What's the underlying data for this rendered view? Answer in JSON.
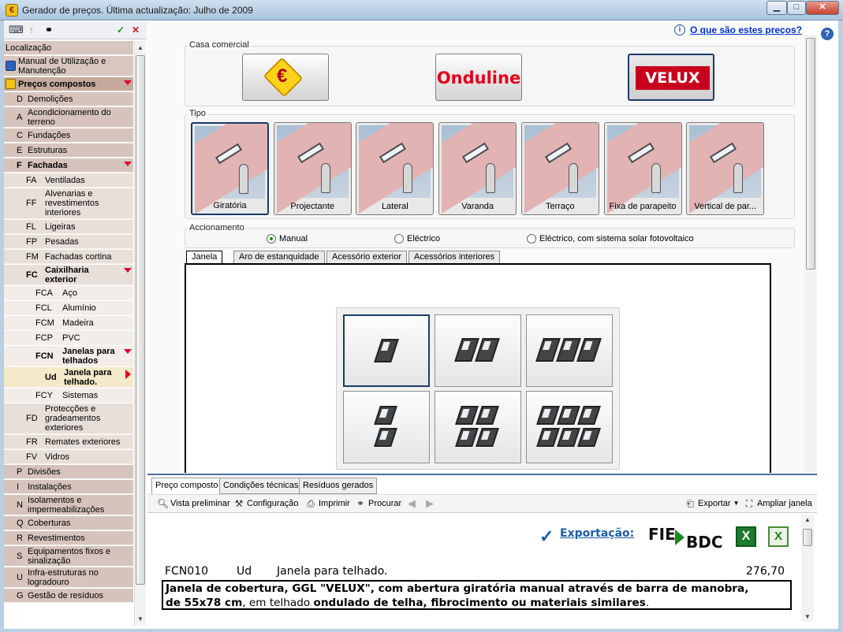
{
  "window": {
    "title": "Gerador de preços. Última actualização: Julho de 2009",
    "app_icon": "euro-icon"
  },
  "help_link": "O que são estes preços?",
  "tree": [
    {
      "code": "",
      "label": "Localização",
      "level": 0,
      "bg": "#d9c7bf"
    },
    {
      "code": "",
      "label": "Manual de Utilização e Manutenção",
      "level": 0,
      "bg": "#d9c7bf",
      "icon": "pencil-icon"
    },
    {
      "code": "",
      "label": "Preços compostos",
      "level": 0,
      "bg": "#c4a99c",
      "bold": true,
      "expanded": true,
      "icon": "euro-icon"
    },
    {
      "code": "D",
      "label": "Demolições",
      "level": 1
    },
    {
      "code": "A",
      "label": "Acondicionamento do terreno",
      "level": 1
    },
    {
      "code": "C",
      "label": "Fundações",
      "level": 1
    },
    {
      "code": "E",
      "label": "Estruturas",
      "level": 1
    },
    {
      "code": "F",
      "label": "Fachadas",
      "level": 1,
      "bold": true,
      "expanded": true
    },
    {
      "code": "FA",
      "label": "Ventiladas",
      "level": 2
    },
    {
      "code": "FF",
      "label": "Alvenarias e revestimentos interiores",
      "level": 2
    },
    {
      "code": "FL",
      "label": "Ligeiras",
      "level": 2
    },
    {
      "code": "FP",
      "label": "Pesadas",
      "level": 2
    },
    {
      "code": "FM",
      "label": "Fachadas cortina",
      "level": 2
    },
    {
      "code": "FC",
      "label": "Caixilharia exterior",
      "level": 2,
      "bold": true,
      "expanded": true
    },
    {
      "code": "FCA",
      "label": "Aço",
      "level": 3
    },
    {
      "code": "FCL",
      "label": "Alumínio",
      "level": 3
    },
    {
      "code": "FCM",
      "label": "Madeira",
      "level": 3
    },
    {
      "code": "FCP",
      "label": "PVC",
      "level": 3
    },
    {
      "code": "FCN",
      "label": "Janelas para telhados",
      "level": 3,
      "bold": true,
      "expanded": true
    },
    {
      "code": "Ud",
      "label": "Janela para telhado.",
      "level": 4,
      "bold": true,
      "selected": true
    },
    {
      "code": "FCY",
      "label": "Sistemas",
      "level": 3
    },
    {
      "code": "FD",
      "label": "Protecções e gradeamentos exteriores",
      "level": 2
    },
    {
      "code": "FR",
      "label": "Remates exteriores",
      "level": 2
    },
    {
      "code": "FV",
      "label": "Vidros",
      "level": 2
    },
    {
      "code": "P",
      "label": "Divisões",
      "level": 1
    },
    {
      "code": "I",
      "label": "Instalações",
      "level": 1
    },
    {
      "code": "N",
      "label": "Isolamentos e impermeabilizações",
      "level": 1
    },
    {
      "code": "Q",
      "label": "Coberturas",
      "level": 1
    },
    {
      "code": "R",
      "label": "Revestimentos",
      "level": 1
    },
    {
      "code": "S",
      "label": "Equipamentos fixos e sinalização",
      "level": 1
    },
    {
      "code": "U",
      "label": "Infra-estruturas no logradouro",
      "level": 1
    },
    {
      "code": "G",
      "label": "Gestão de resíduos",
      "level": 1
    }
  ],
  "casa_comercial": {
    "label": "Casa comercial",
    "brands": [
      {
        "name": "euro-brand",
        "text": "€",
        "selected": false
      },
      {
        "name": "onduline",
        "text": "Onduline",
        "selected": false
      },
      {
        "name": "velux",
        "text": "VELUX",
        "selected": true
      }
    ]
  },
  "tipo": {
    "label": "Tipo",
    "options": [
      "Giratória",
      "Projectante",
      "Lateral",
      "Varanda",
      "Terraço",
      "Fixa de parapeito",
      "Vertical de par..."
    ],
    "selected_index": 0
  },
  "accionamento": {
    "label": "Accionamento",
    "options": [
      "Manual",
      "Eléctrico",
      "Eléctrico, com sistema solar fotovoltaico"
    ],
    "selected_index": 0
  },
  "tabs": [
    "Janela",
    "Aro de estanquidade",
    "Acessório exterior",
    "Acessórios interiores"
  ],
  "bottom_tabs": [
    "Preço composto",
    "Condições técnicas",
    "Resíduos gerados"
  ],
  "toolbar": {
    "preview": "Vista preliminar",
    "config": "Configuração",
    "print": "Imprimir",
    "search": "Procurar",
    "export": "Exportar",
    "enlarge": "Ampliar janela"
  },
  "export_label": "Exportação:",
  "export_formats": [
    "FIE",
    "BDC"
  ],
  "price_line": {
    "code": "FCN010",
    "unit": "Ud",
    "name": "Janela para telhado.",
    "price": "276,70"
  },
  "description": {
    "p1": "Janela de cobertura, GGL \"VELUX\", com abertura giratória manual através de barra de manobra,",
    "p2a": "de 55x78 cm",
    "p2b": ", em telhado ",
    "p2c": "ondulado de telha, fibrocimento ou materiais similares",
    "p2d": "."
  }
}
